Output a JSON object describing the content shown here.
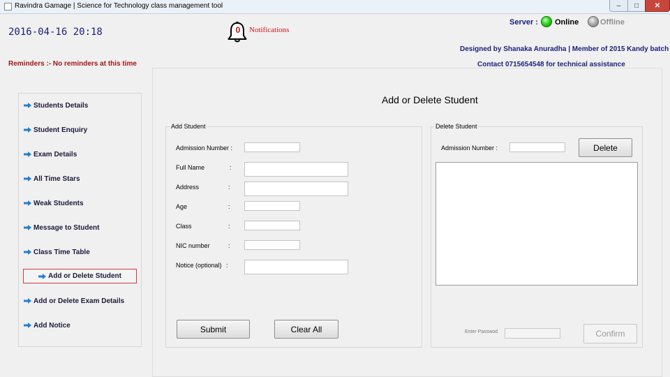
{
  "window": {
    "title": "Ravindra Gamage | Science for Technology class management tool",
    "controls": {
      "minimize": "–",
      "maximize": "□",
      "close": "✕"
    }
  },
  "header": {
    "datetime": "2016-04-16 20:18",
    "notifications": {
      "count": "0",
      "label": "Notifications",
      "icon": "bell-icon"
    },
    "server": {
      "label": "Server :",
      "online_label": "Online",
      "offline_label": "Offline",
      "online_color": "#2ed61e",
      "offline_color": "#a9a9a9"
    },
    "designed_by": "Designed by Shanaka Anuradha | Member of 2015 Kandy  batch",
    "contact": "Contact 0715654548 for technical assistance",
    "reminders": "Reminders :- No reminders at this time"
  },
  "sidebar": {
    "items": [
      {
        "label": "Students Details"
      },
      {
        "label": "Student Enquiry"
      },
      {
        "label": "Exam Details"
      },
      {
        "label": "All Time Stars"
      },
      {
        "label": "Weak Students"
      },
      {
        "label": "Message to Student"
      },
      {
        "label": "Class Time Table"
      },
      {
        "label": "Add or Delete Student",
        "active": true
      },
      {
        "label": "Add or Delete Exam Details"
      },
      {
        "label": "Add Notice"
      }
    ],
    "arrow_color": "#1e7fd0",
    "active_border_color": "#cf3a3a"
  },
  "main": {
    "title": "Add or Delete Student",
    "add_student": {
      "group_title": "Add Student",
      "fields": [
        {
          "label": "Admission Number :",
          "colon": "",
          "value": ""
        },
        {
          "label": "Full Name",
          "colon": ":",
          "value": ""
        },
        {
          "label": "Address",
          "colon": ":",
          "value": ""
        },
        {
          "label": "Age",
          "colon": ":",
          "value": ""
        },
        {
          "label": "Class",
          "colon": ":",
          "value": ""
        },
        {
          "label": "NIC number",
          "colon": ":",
          "value": ""
        },
        {
          "label": "Notice (optional)",
          "colon": ":",
          "value": ""
        }
      ],
      "submit_label": "Submit",
      "clear_label": "Clear All"
    },
    "delete_student": {
      "group_title": "Delete Student",
      "admission_label": "Admission Number :",
      "admission_value": "",
      "delete_label": "Delete",
      "password_label": "Enter Passwod",
      "confirm_label": "Confirm"
    }
  }
}
